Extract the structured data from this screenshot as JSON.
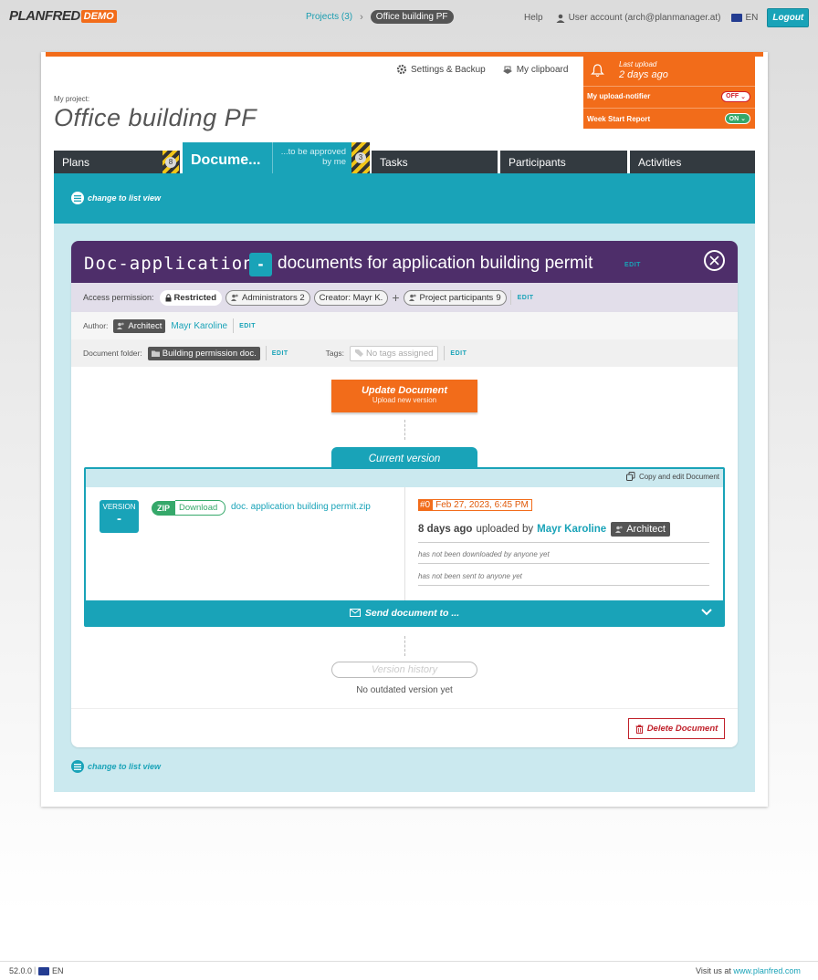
{
  "header": {
    "logo_text": "PLANFRED",
    "logo_badge": "DEMO",
    "breadcrumb_projects": "Projects (3)",
    "breadcrumb_current": "Office building PF",
    "help": "Help",
    "user_account": "User account (arch@planmanager.at)",
    "language": "EN",
    "logout": "Logout"
  },
  "toolbar": {
    "settings": "Settings & Backup",
    "clipboard": "My clipboard"
  },
  "notifications": {
    "last_upload_label": "Last upload",
    "last_upload_value": "2 days ago",
    "upload_notifier_label": "My upload-notifier",
    "upload_notifier_state": "OFF",
    "week_report_label": "Week Start Report",
    "week_report_state": "ON"
  },
  "project": {
    "label": "My project:",
    "title": "Office building PF"
  },
  "tabs": {
    "plans": "Plans",
    "plans_count": "8",
    "documents": "Docume...",
    "to_be_approved": "...to be approved by me",
    "approve_count": "3",
    "tasks": "Tasks",
    "participants": "Participants",
    "activities": "Activities"
  },
  "list_view_label": "change to list view",
  "document": {
    "code": "Doc-application",
    "version_symbol": "-",
    "title": "documents for application building permit",
    "edit": "EDIT",
    "access_label": "Access permission:",
    "access_restricted": "Restricted",
    "access_admins": "Administrators 2",
    "access_creator": "Creator: Mayr K.",
    "access_participants": "Project participants",
    "access_participants_count": "9",
    "author_label": "Author:",
    "author_role": "Architect",
    "author_name": "Mayr Karoline",
    "folder_label": "Document folder:",
    "folder_name": "Building permission doc.",
    "tags_label": "Tags:",
    "tags_value": "No tags assigned",
    "update_button": "Update Document",
    "update_sub": "Upload new version",
    "current_version": "Current version",
    "copy_edit": "Copy and edit Document",
    "version_label": "VERSION",
    "version_value": "-",
    "zip_label": "ZIP",
    "download_label": "Download",
    "file_name": "doc. application building permit.zip",
    "version_number": "#0",
    "version_date": "Feb 27, 2023, 6:45 PM",
    "uploaded_ago": "8 days ago",
    "uploaded_by": "uploaded by",
    "uploader_name": "Mayr Karoline",
    "uploader_role": "Architect",
    "not_downloaded": "has not been downloaded by anyone yet",
    "not_sent": "has not been sent to anyone yet",
    "send_label": "Send document to ...",
    "version_history": "Version history",
    "no_outdated": "No outdated version yet",
    "delete_button": "Delete Document"
  },
  "footer": {
    "version": "52.0.0",
    "language": "EN",
    "visit_text": "Visit us at",
    "visit_link": "www.planfred.com"
  },
  "colors": {
    "accent_teal": "#19a3b8",
    "accent_orange": "#f26c1a",
    "doc_header_purple": "#4e2e6a",
    "delete_red": "#c0202a",
    "zip_green": "#35a86a"
  }
}
